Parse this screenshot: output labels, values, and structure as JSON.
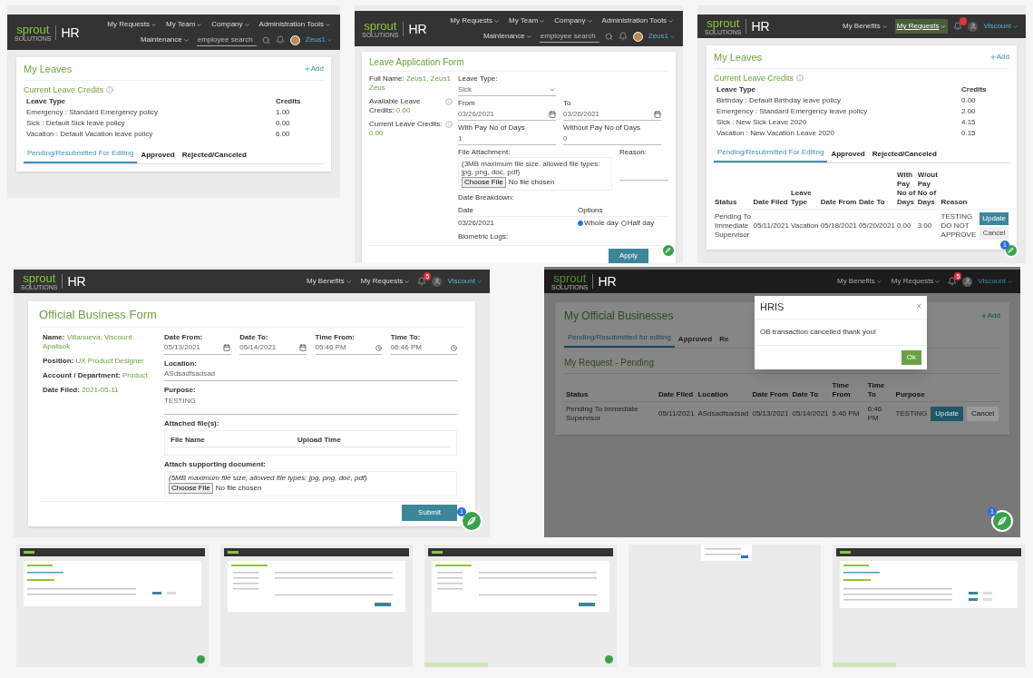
{
  "screens": [
    {
      "kind": "leaves_list",
      "header": {
        "logo": "sprout",
        "logo_sub": "SOLUTIONS",
        "app": "HR",
        "menu": [
          {
            "label": "My Requests",
            "highlighted": false
          },
          {
            "label": "My Team",
            "highlighted": false
          },
          {
            "label": "Company",
            "highlighted": false
          },
          {
            "label": "Administration Tools",
            "highlighted": false
          },
          {
            "label": "Maintenance",
            "highlighted": false
          }
        ],
        "search_placeholder": "employee search",
        "alert": false,
        "avatar_photo": true,
        "user": "Zeus1"
      },
      "title": "My Leaves",
      "add": "Add",
      "credits_title": "Current Leave Credits",
      "credit_columns": [
        "Leave Type",
        "Credits"
      ],
      "credits": [
        [
          "Emergency : Standard Emergency policy",
          "1.00"
        ],
        [
          "Sick : Default Sick leave policy",
          "0.00"
        ],
        [
          "Vacation : Default Vacation leave policy",
          "6.00"
        ]
      ],
      "tabs": [
        {
          "label": "Pending/Resubmitted For Editing",
          "selected": true
        },
        {
          "label": "Approved",
          "selected": false
        },
        {
          "label": "Rejected/Canceled",
          "selected": false
        }
      ],
      "chat": false
    },
    {
      "kind": "leave_form",
      "header": {
        "logo": "sprout",
        "logo_sub": "SOLUTIONS",
        "app": "HR",
        "menu": [
          {
            "label": "My Requests",
            "highlighted": false
          },
          {
            "label": "My Team",
            "highlighted": false
          },
          {
            "label": "Company",
            "highlighted": false
          },
          {
            "label": "Administration Tools",
            "highlighted": false
          },
          {
            "label": "Maintenance",
            "highlighted": false
          }
        ],
        "search_placeholder": "employee search",
        "alert": false,
        "avatar_photo": true,
        "user": "Zeus1"
      },
      "title": "Leave Application Form",
      "info": [
        {
          "label": "Full Name:",
          "value": "Zeus1, Zeus1 Zeus"
        },
        {
          "label": "Available Leave Credits:",
          "value": "0.00"
        },
        {
          "label": "Current Leave Credits:",
          "value": "0.00"
        }
      ],
      "leave_type": {
        "label": "Leave Type:",
        "value": "Sick"
      },
      "from": {
        "label": "From",
        "value": "03/26/2021"
      },
      "to": {
        "label": "To",
        "value": "03/26/2021"
      },
      "with_pay": {
        "label": "With Pay No of Days",
        "value": "1"
      },
      "without_pay": {
        "label": "Without Pay No of Days",
        "value": "0"
      },
      "attachment": {
        "label": "File Attachment:",
        "hint": "(3MB maximum file size. allowed file types: jpg, png, doc, pdf)",
        "button": "Choose File",
        "status": "No file chosen"
      },
      "reason": {
        "label": "Reason:"
      },
      "breakdown": {
        "label": "Date Breakdown:",
        "columns": [
          "Date",
          "Options"
        ],
        "rows": [
          {
            "date": "03/26/2021",
            "options": [
              {
                "label": "Whole day",
                "selected": true
              },
              {
                "label": "Half day",
                "selected": false
              }
            ]
          }
        ]
      },
      "biometric": "Biometric Logs:",
      "submit": "Apply",
      "chat": true
    },
    {
      "kind": "leaves_list",
      "header": {
        "logo": "sprout",
        "logo_sub": "SOLUTIONS",
        "app": "HR",
        "menu": [
          {
            "label": "My Benefits",
            "highlighted": false
          },
          {
            "label": "My Requests",
            "highlighted": true
          }
        ],
        "alert": true,
        "avatar_photo": false,
        "user": "Viscount"
      },
      "title": "My Leaves",
      "add": "Add",
      "credits_title": "Current Leave Credits",
      "credit_columns": [
        "Leave Type",
        "Credits"
      ],
      "credits": [
        [
          "Birthday : Default Birthday leave policy",
          "0.00"
        ],
        [
          "Emergency : Standard Emergency leave policy",
          "2.00"
        ],
        [
          "Sick : New Sick Leave 2020",
          "4.15"
        ],
        [
          "Vacation : New Vacation Leave 2020",
          "0.15"
        ]
      ],
      "tabs": [
        {
          "label": "Pending/Resubmitted For Editing",
          "selected": true
        },
        {
          "label": "Approved",
          "selected": false
        },
        {
          "label": "Rejected/Canceled",
          "selected": false
        }
      ],
      "table": {
        "columns": [
          "Status",
          "Date Filed",
          "Leave Type",
          "Date From",
          "Date To",
          "With Pay No of Days",
          "W/out Pay No of Days",
          "Reason"
        ],
        "rows": [
          {
            "cells": [
              "Pending To Immediate Supervisor",
              "05/11/2021",
              "Vacation",
              "05/18/2021",
              "05/20/2021",
              "0.00",
              "3.00",
              "TESTING DO NOT APPROVE"
            ],
            "update": "Update",
            "cancel": "Cancel"
          }
        ]
      },
      "chat": true,
      "chat_badge": "1"
    },
    {
      "kind": "ob_form",
      "header": {
        "logo": "sprout",
        "logo_sub": "SOLUTIONS",
        "app": "HR",
        "menu": [
          {
            "label": "My Benefits",
            "highlighted": false
          },
          {
            "label": "My Requests",
            "highlighted": false
          }
        ],
        "alert": true,
        "badge": "5",
        "avatar_photo": false,
        "user": "Viscount"
      },
      "title": "Official Business Form",
      "info": [
        {
          "label": "Name:",
          "value": "Villanueva, Viscount Apalisok"
        },
        {
          "label": "Position:",
          "value": "UX Product Designer"
        },
        {
          "label": "Account / Department:",
          "value": "Product"
        },
        {
          "label": "Date Filed:",
          "value": "2021-05-11"
        }
      ],
      "times": [
        {
          "label": "Date From:",
          "value": "05/13/2021",
          "kind": "date"
        },
        {
          "label": "Date To:",
          "value": "05/14/2021",
          "kind": "date"
        },
        {
          "label": "Time From:",
          "value": "05:46 PM",
          "kind": "time"
        },
        {
          "label": "Time To:",
          "value": "06:46 PM",
          "kind": "time"
        }
      ],
      "location": {
        "label": "Location:",
        "value": "ASdsadfsadsad"
      },
      "purpose": {
        "label": "Purpose:",
        "value": "TESTING"
      },
      "attached": {
        "label": "Attached file(s):",
        "columns": [
          "File Name",
          "Upload Time"
        ]
      },
      "attach": {
        "label": "Attach supporting document:",
        "hint": "(5MB maximum file size, allowed file types: jpg, png, doc, pdf)",
        "button": "Choose File",
        "status": "No file chosen"
      },
      "submit": "Submit",
      "chat": true,
      "chat_badge": "1"
    },
    {
      "kind": "ob_list",
      "header": {
        "logo": "sprout",
        "logo_sub": "SOLUTIONS",
        "app": "HR",
        "menu": [
          {
            "label": "My Benefits",
            "highlighted": false
          },
          {
            "label": "My Requests",
            "highlighted": false
          }
        ],
        "alert": true,
        "badge": "5",
        "avatar_photo": false,
        "user": "Viscount"
      },
      "title": "My Official Businesses",
      "add": "Add",
      "tabs": [
        {
          "label": "Pending/Resubmitted for editing",
          "selected": true
        },
        {
          "label": "Approved",
          "selected": false
        },
        {
          "label": "Re",
          "selected": false
        }
      ],
      "subtitle": "My Request - Pending",
      "table": {
        "columns": [
          "Status",
          "Date Filed",
          "Location",
          "Date From",
          "Date To",
          "Time From",
          "Time To",
          "Purpose"
        ],
        "rows": [
          {
            "cells": [
              "Pending To Immediate Supervisor",
              "05/11/2021",
              "ASdsadfsadsad",
              "05/13/2021",
              "05/14/2021",
              "5:46 PM",
              "6:46 PM",
              "TESTING"
            ],
            "update": "Update",
            "cancel": "Cancel"
          }
        ]
      },
      "dialog": {
        "title": "HRIS",
        "close": "×",
        "message": "OB transaction cancelled thank you!",
        "ok": "Ok"
      },
      "chat": true,
      "chat_badge": "1"
    }
  ],
  "thumbnails": [
    {
      "kind": "list",
      "chat": true,
      "status_bar": false
    },
    {
      "kind": "form",
      "chat": false,
      "status_bar": false
    },
    {
      "kind": "form",
      "chat": true,
      "status_bar": true
    },
    {
      "kind": "dialog",
      "chat": false,
      "status_bar": false
    },
    {
      "kind": "list_long",
      "chat": false,
      "status_bar": true
    }
  ]
}
